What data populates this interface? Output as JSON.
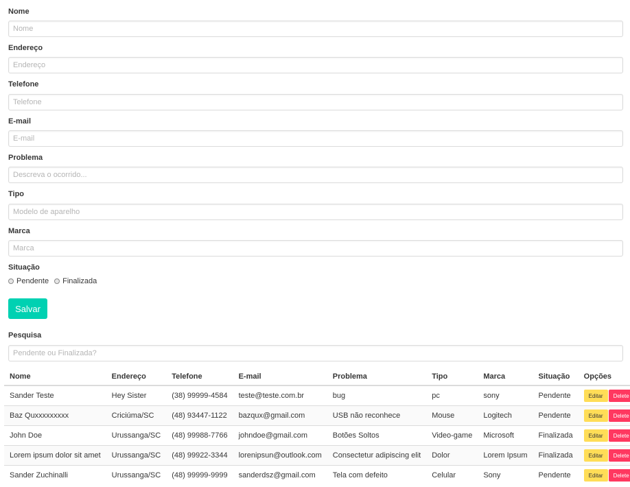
{
  "form": {
    "nome": {
      "label": "Nome",
      "placeholder": "Nome",
      "value": ""
    },
    "endereco": {
      "label": "Endereço",
      "placeholder": "Endereço",
      "value": ""
    },
    "telefone": {
      "label": "Telefone",
      "placeholder": "Telefone",
      "value": ""
    },
    "email": {
      "label": "E-mail",
      "placeholder": "E-mail",
      "value": ""
    },
    "problema": {
      "label": "Problema",
      "placeholder": "Descreva o ocorrido...",
      "value": ""
    },
    "tipo": {
      "label": "Tipo",
      "placeholder": "Modelo de aparelho",
      "value": ""
    },
    "marca": {
      "label": "Marca",
      "placeholder": "Marca",
      "value": ""
    },
    "situacao": {
      "label": "Situação",
      "options": [
        "Pendente",
        "Finalizada"
      ]
    },
    "save_label": "Salvar"
  },
  "search": {
    "label": "Pesquisa",
    "placeholder": "Pendente ou Finalizada?",
    "value": ""
  },
  "table": {
    "headers": [
      "Nome",
      "Endereço",
      "Telefone",
      "E-mail",
      "Problema",
      "Tipo",
      "Marca",
      "Situação",
      "Opções"
    ],
    "edit_label": "Editar",
    "delete_label": "Delete",
    "rows": [
      [
        "Sander Teste",
        "Hey Sister",
        "(38) 99999-4584",
        "teste@teste.com.br",
        "bug",
        "pc",
        "sony",
        "Pendente"
      ],
      [
        "Baz Quxxxxxxxxx",
        "Criciúma/SC",
        "(48) 93447-1122",
        "bazqux@gmail.com",
        "USB não reconhece",
        "Mouse",
        "Logitech",
        "Pendente"
      ],
      [
        "John Doe",
        "Urussanga/SC",
        "(48) 99988-7766",
        "johndoe@gmail.com",
        "Botões Soltos",
        "Video-game",
        "Microsoft",
        "Finalizada"
      ],
      [
        "Lorem ipsum dolor sit amet",
        "Urussanga/SC",
        "(48) 99922-3344",
        "lorenipsun@outlook.com",
        "Consectetur adipiscing elit",
        "Dolor",
        "Lorem Ipsum",
        "Finalizada"
      ],
      [
        "Sander Zuchinalli",
        "Urussanga/SC",
        "(48) 99999-9999",
        "sanderdsz@gmail.com",
        "Tela com defeito",
        "Celular",
        "Sony",
        "Pendente"
      ]
    ]
  },
  "colors": {
    "primary": "#00d1b2",
    "warning": "#ffdd57",
    "danger": "#ff3860"
  }
}
